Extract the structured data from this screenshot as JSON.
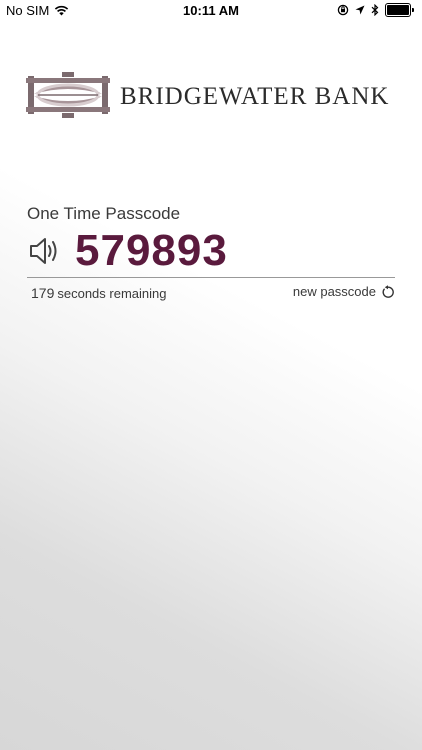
{
  "status_bar": {
    "carrier": "No SIM",
    "time": "10:11 AM",
    "icons": [
      "wifi-icon",
      "orientation-lock-icon",
      "location-icon",
      "bluetooth-icon",
      "battery-icon"
    ]
  },
  "brand": {
    "name": "BRIDGEWATER BANK",
    "logo_colors": [
      "#7b6a6e",
      "#a89599",
      "#d8cdcf"
    ]
  },
  "otp": {
    "label": "One Time Passcode",
    "code": "579893",
    "code_color": "#5a1a3d",
    "seconds": "179",
    "seconds_suffix": "seconds remaining",
    "new_passcode_label": "new passcode",
    "speaker_icon": "speaker-icon",
    "refresh_icon": "refresh-icon"
  }
}
